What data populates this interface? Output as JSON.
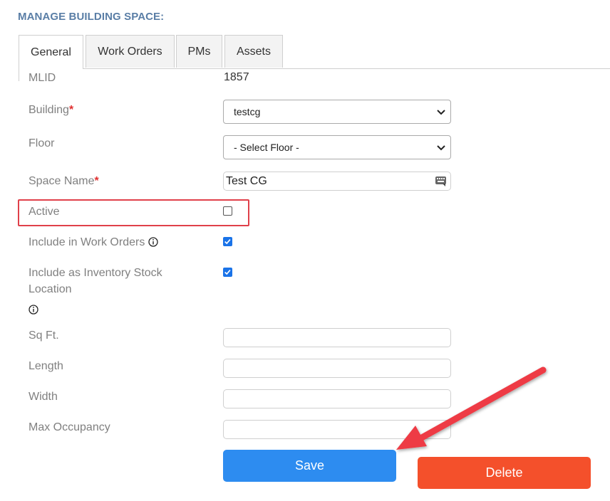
{
  "page": {
    "section_title": "MANAGE BUILDING SPACE:"
  },
  "tabs": [
    {
      "label": "General",
      "active": true
    },
    {
      "label": "Work Orders",
      "active": false
    },
    {
      "label": "PMs",
      "active": false
    },
    {
      "label": "Assets",
      "active": false
    }
  ],
  "form": {
    "mlid": {
      "label": "MLID",
      "value": "1857"
    },
    "building": {
      "label": "Building",
      "required_mark": "*",
      "value": "testcg"
    },
    "floor": {
      "label": "Floor",
      "value": "- Select Floor -"
    },
    "space_name": {
      "label": "Space Name",
      "required_mark": "*",
      "value": "Test CG"
    },
    "active": {
      "label": "Active",
      "checked": false
    },
    "include_work_orders": {
      "label": "Include in Work Orders",
      "checked": true
    },
    "include_inventory": {
      "label_line1": "Include as Inventory Stock",
      "label_line2": "Location",
      "checked": true
    },
    "sq_ft": {
      "label": "Sq Ft.",
      "value": ""
    },
    "length": {
      "label": "Length",
      "value": ""
    },
    "width": {
      "label": "Width",
      "value": ""
    },
    "max_occupancy": {
      "label": "Max Occupancy",
      "value": ""
    }
  },
  "buttons": {
    "save_label": "Save",
    "delete_label": "Delete"
  },
  "colors": {
    "accent_blue": "#2d8cf0",
    "delete_red": "#f4502b",
    "highlight_red": "#e0404a",
    "title_blue": "#5a7ea6"
  }
}
